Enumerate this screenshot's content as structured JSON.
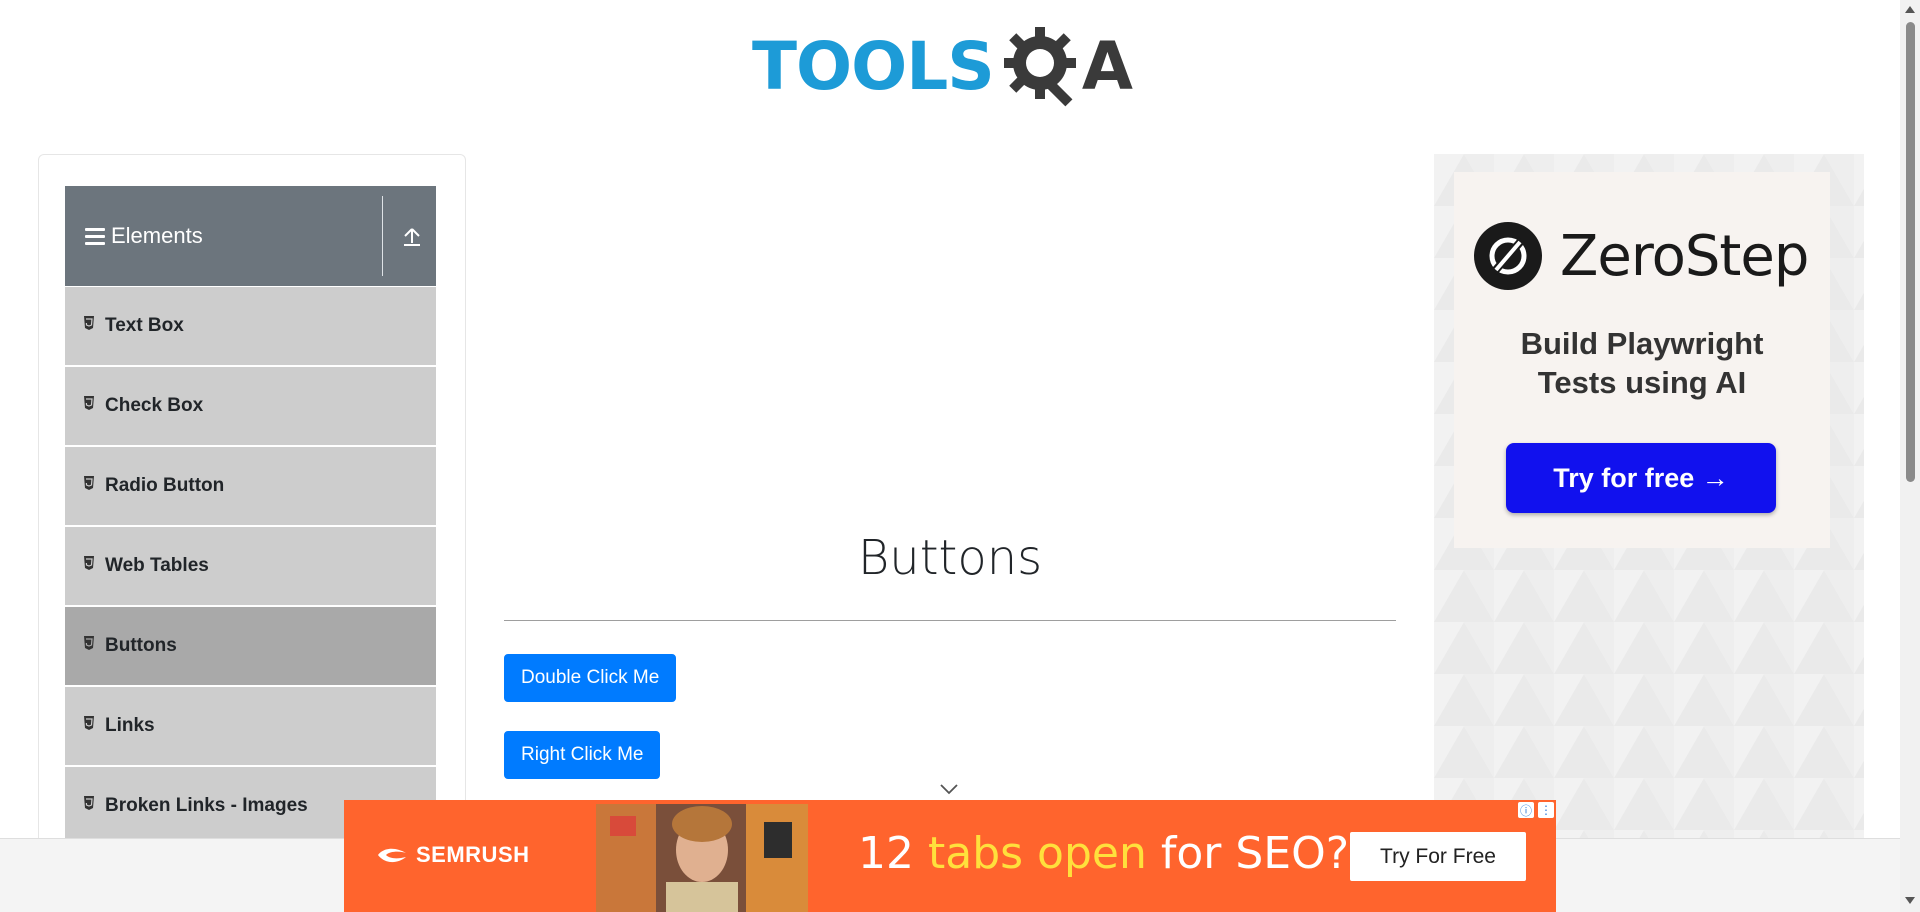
{
  "logo": {
    "tools": "TOOLS",
    "qa": "A",
    "gear_letter": "Q"
  },
  "sidebar": {
    "group_title": "Elements",
    "items": [
      {
        "label": "Text Box",
        "active": false
      },
      {
        "label": "Check Box",
        "active": false
      },
      {
        "label": "Radio Button",
        "active": false
      },
      {
        "label": "Web Tables",
        "active": false
      },
      {
        "label": "Buttons",
        "active": true
      },
      {
        "label": "Links",
        "active": false
      },
      {
        "label": "Broken Links - Images",
        "active": false
      }
    ]
  },
  "main": {
    "title": "Buttons",
    "buttons": {
      "double_click": "Double Click Me",
      "right_click": "Right Click Me"
    }
  },
  "right_ad": {
    "brand": "ZeroStep",
    "tagline_1": "Build Playwright",
    "tagline_2": "Tests using AI",
    "cta": "Try for free →"
  },
  "bottom_ad": {
    "brand": "SEMRUSH",
    "text_pre": "12 ",
    "text_highlight": "tabs open",
    "text_post": " for SEO?",
    "cta": "Try For Free"
  },
  "colors": {
    "accent": "#007bff",
    "sidebar_header": "#6c757d",
    "banner": "#ff642d",
    "zs_button": "#1111ee"
  }
}
